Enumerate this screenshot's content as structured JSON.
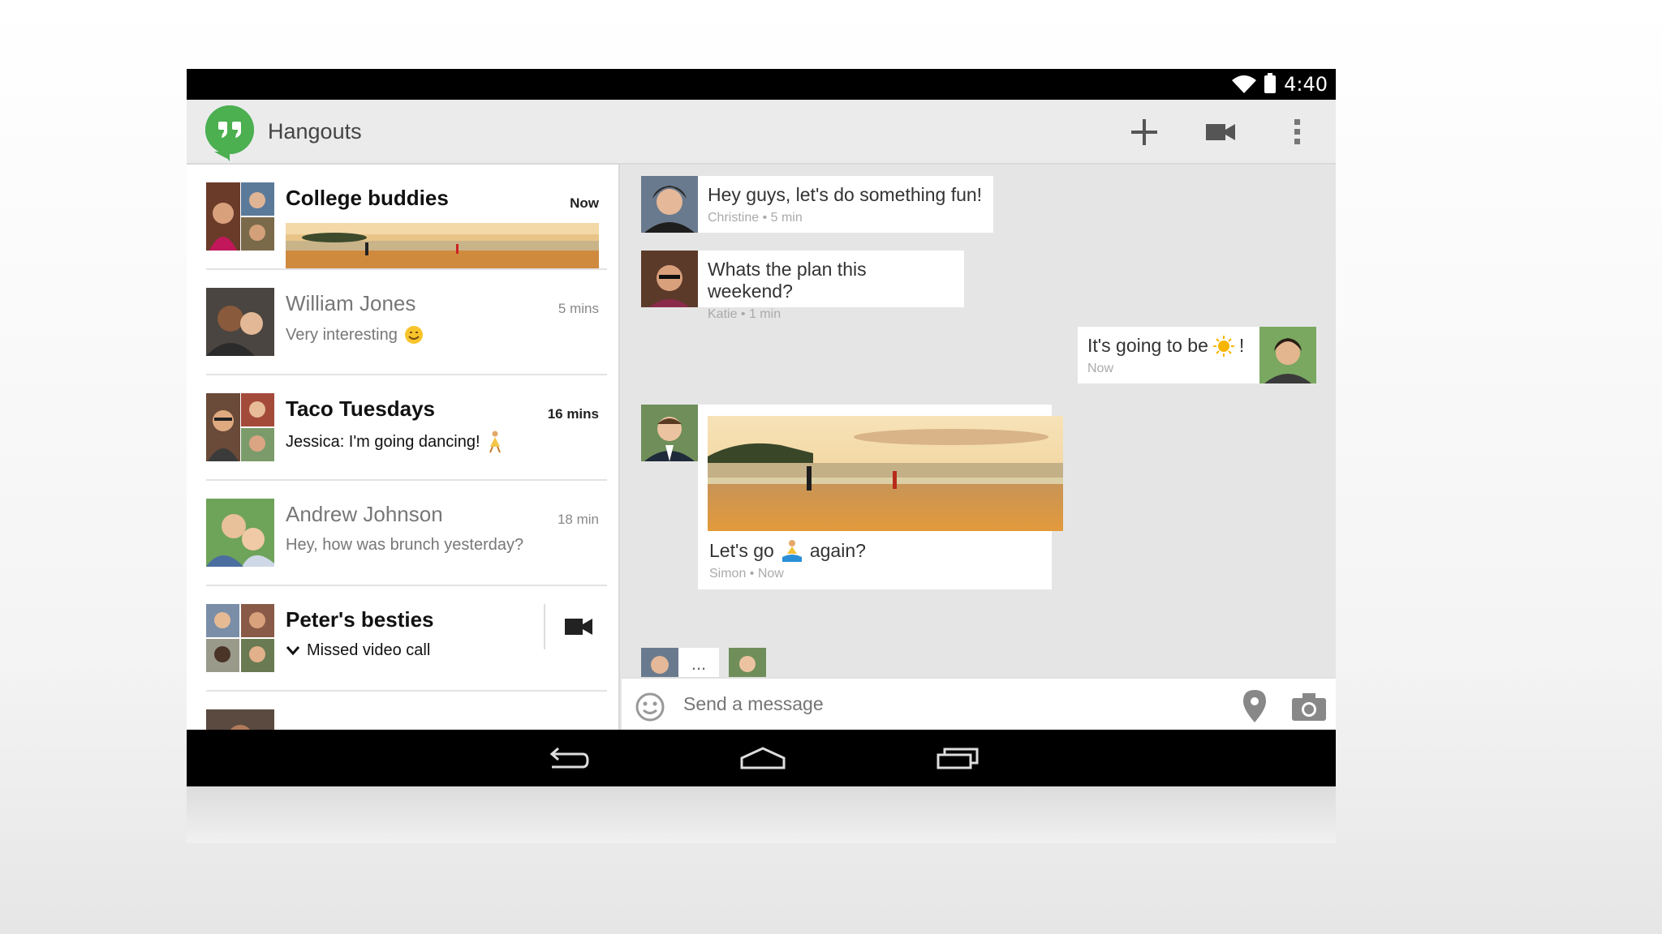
{
  "status_bar": {
    "time": "4:40"
  },
  "app": {
    "title": "Hangouts"
  },
  "actions": {
    "new": "plus-icon",
    "video": "video-camera-icon",
    "overflow": "more-vert-icon"
  },
  "conversations": [
    {
      "name": "College buddies",
      "time": "Now",
      "snippet": "",
      "unread": true
    },
    {
      "name": "William Jones",
      "time": "5 mins",
      "snippet": "Very interesting",
      "unread": false
    },
    {
      "name": "Taco Tuesdays",
      "time": "16 mins",
      "snippet": "Jessica: I'm going dancing!",
      "unread": true
    },
    {
      "name": "Andrew Johnson",
      "time": "18 min",
      "snippet": "Hey, how was brunch yesterday?",
      "unread": false
    },
    {
      "name": "Peter's besties",
      "time": "",
      "snippet": "Missed video call",
      "unread": true
    }
  ],
  "messages": [
    {
      "text": "Hey guys, let's do something fun!",
      "sender": "Christine",
      "time": "5 min",
      "meta": "Christine • 5 min"
    },
    {
      "text": "Whats the plan this weekend?",
      "sender": "Katie",
      "time": "1 min",
      "meta": "Katie • 1 min"
    },
    {
      "text_before": "It's going to be",
      "text_after": "!",
      "meta": "Now"
    },
    {
      "text_before": "Let's go",
      "text_after": "again?",
      "sender": "Simon",
      "time": "Now",
      "meta": "Simon • Now"
    }
  ],
  "typing": {
    "dots": "..."
  },
  "compose": {
    "placeholder": "Send a message"
  },
  "colors": {
    "hangouts_green": "#4caf50",
    "status_bar": "#000000",
    "chat_bg": "#e5e5e5",
    "list_bg": "#ffffff"
  }
}
